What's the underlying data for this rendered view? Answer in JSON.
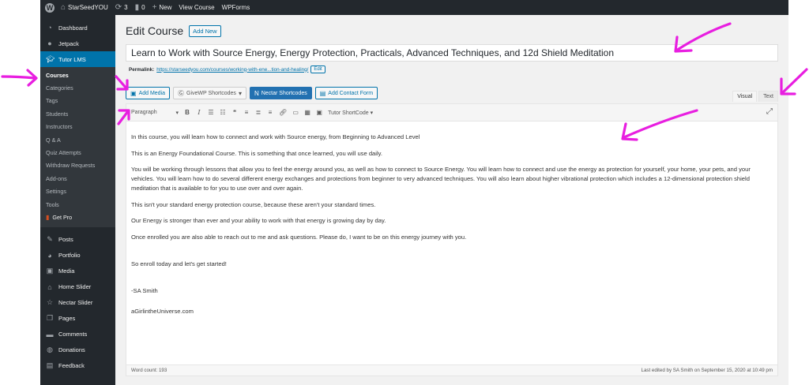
{
  "admin_bar": {
    "site_name": "StarSeedYOU",
    "updates_count": "3",
    "comments_count": "0",
    "new_label": "New",
    "view_course_label": "View Course",
    "wpforms_label": "WPForms"
  },
  "sidebar": {
    "top_items": [
      {
        "label": "Dashboard",
        "icon": "dashboard-icon"
      },
      {
        "label": "Jetpack",
        "icon": "jetpack-icon"
      }
    ],
    "active_item": {
      "label": "Tutor LMS",
      "icon": "graduation-cap-icon"
    },
    "submenu": [
      "Courses",
      "Categories",
      "Tags",
      "Students",
      "Instructors",
      "Q & A",
      "Quiz Attempts",
      "Withdraw Requests",
      "Add-ons",
      "Settings",
      "Tools"
    ],
    "get_pro_label": "Get Pro",
    "bottom_items": [
      {
        "label": "Posts",
        "icon": "pin-icon"
      },
      {
        "label": "Portfolio",
        "icon": "portfolio-icon"
      },
      {
        "label": "Media",
        "icon": "media-icon"
      },
      {
        "label": "Home Slider",
        "icon": "home-icon"
      },
      {
        "label": "Nectar Slider",
        "icon": "star-icon"
      },
      {
        "label": "Pages",
        "icon": "pages-icon"
      },
      {
        "label": "Comments",
        "icon": "comments-icon"
      },
      {
        "label": "Donations",
        "icon": "donations-icon"
      },
      {
        "label": "Feedback",
        "icon": "feedback-icon"
      }
    ]
  },
  "main": {
    "page_title": "Edit Course",
    "add_new_label": "Add New",
    "post_title": "Learn to Work with Source Energy, Energy Protection, Practicals, Advanced Techniques, and 12d Shield Meditation",
    "permalink": {
      "label": "Permalink:",
      "url": "https://starseedyou.com/courses/working-with-ene...tion-and-healing/",
      "edit_label": "Edit"
    },
    "media_buttons": {
      "add_media": "Add Media",
      "givewp": "GiveWP Shortcodes",
      "nectar": "Nectar Shortcodes",
      "contact_form": "Add Contact Form"
    },
    "editor_tabs": {
      "visual": "Visual",
      "text": "Text"
    },
    "toolbar": {
      "format_value": "Paragraph",
      "tutor_shortcode": "Tutor ShortCode"
    },
    "content": {
      "p1": "In this course, you will learn how to connect and work with Source energy, from Beginning to Advanced Level",
      "p2": "This is an Energy Foundational Course. This is something that once learned, you will use daily.",
      "p3": "You will be working through lessons that allow you to feel the energy around you, as well as how to connect to Source Energy. You will learn how to connect and use the energy as protection for yourself, your home, your pets, and your vehicles. You will learn how to do several different energy exchanges and protections from beginner to very advanced techniques. You will also learn about higher vibrational protection which includes a 12-dimensional protection shield meditation that is available to for you to use over and over again.",
      "p4": "This isn't your standard energy protection course, because these aren't your standard times.",
      "p5": "Our Energy is stronger than ever and your ability to work with that energy is growing day by day.",
      "p6": "Once enrolled you are also able to reach out to me and ask questions. Please do, I want to be on this energy journey with you.",
      "p7": "So enroll today and let's get started!",
      "p8": "-SA Smith",
      "p9": "aGirlintheUniverse.com"
    },
    "status": {
      "word_count": "Word count: 193",
      "last_edited": "Last edited by SA Smith on September 15, 2020 at 10:49 pm"
    }
  },
  "colors": {
    "admin_dark": "#23282d",
    "wp_blue": "#0073aa",
    "annotation_magenta": "#e81ee0"
  }
}
